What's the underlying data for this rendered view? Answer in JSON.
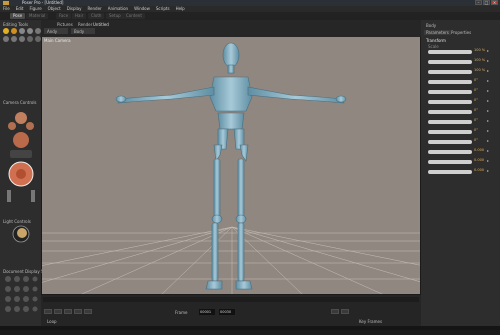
{
  "window": {
    "title": "Poser Pro - [Untitled]"
  },
  "menu": [
    "File",
    "Edit",
    "Figure",
    "Object",
    "Display",
    "Render",
    "Animation",
    "Window",
    "Scripts",
    "Help"
  ],
  "rooms": [
    {
      "label": "Pose",
      "active": true
    },
    {
      "label": "Material",
      "active": false
    },
    {
      "label": "Face",
      "active": false
    },
    {
      "label": "Hair",
      "active": false
    },
    {
      "label": "Cloth",
      "active": false
    },
    {
      "label": "Setup",
      "active": false
    },
    {
      "label": "Content",
      "active": false
    }
  ],
  "left_panel": {
    "editing_tools": "Editing Tools",
    "camera_controls": "Camera Controls",
    "light_controls": "Light Controls",
    "document_display": "Document Display St"
  },
  "viewport_header": {
    "figure_tab": "Pictures",
    "render_tab": "Render",
    "doc_title": "Untitled",
    "figure_select": "Andy",
    "actor_select": "Body",
    "camera_name": "Main Camera"
  },
  "right_panel": {
    "actor": "Body",
    "tabs": [
      "Parameters",
      "Properties"
    ],
    "group": "Transform",
    "sub": "Scale",
    "params": [
      {
        "value": "100 %"
      },
      {
        "value": "100 %"
      },
      {
        "value": "100 %"
      },
      {
        "value": "0°"
      },
      {
        "value": "0°"
      },
      {
        "value": "0°"
      },
      {
        "value": "0°"
      },
      {
        "value": "0°"
      },
      {
        "value": "0°"
      },
      {
        "value": "0°"
      },
      {
        "value": "0.000"
      },
      {
        "value": "0.000"
      },
      {
        "value": "0.000"
      }
    ]
  },
  "timeline": {
    "frame_label": "Frame",
    "frame_value": "00001",
    "total_frames": "00030",
    "loop_label": "Loop",
    "keyframes_label": "Key Frames"
  }
}
